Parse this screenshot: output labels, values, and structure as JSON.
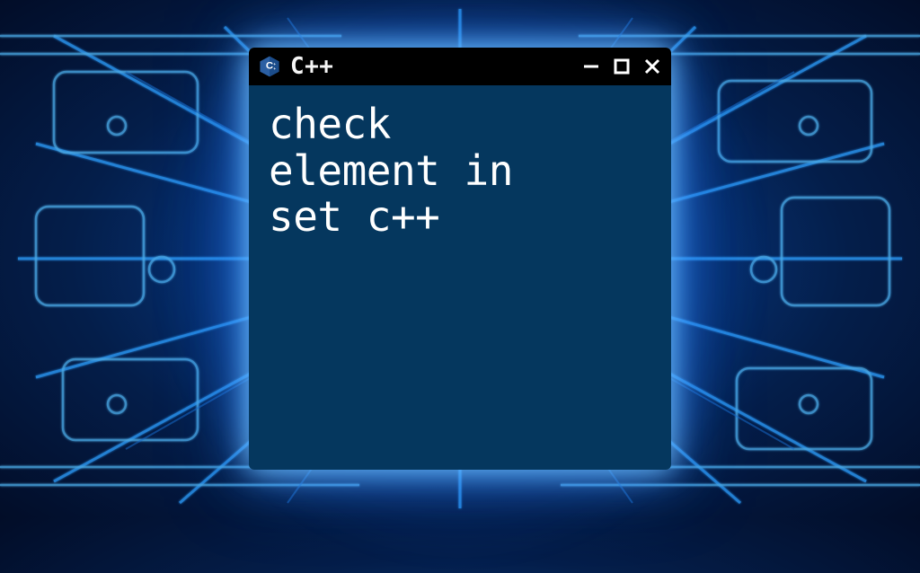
{
  "window": {
    "title": "C++",
    "language_icon": "cpp-icon",
    "controls": {
      "minimize": "-",
      "maximize": "□",
      "close": "×"
    }
  },
  "terminal": {
    "content": "check\nelement in\nset c++"
  },
  "colors": {
    "terminal_bg": "#05375e",
    "terminal_text": "#ffffff",
    "titlebar_bg": "#000000",
    "glow": "#3aa0ff"
  }
}
